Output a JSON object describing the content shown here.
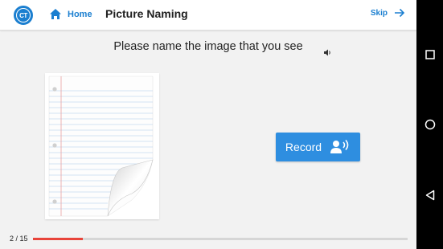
{
  "header": {
    "logo_text": "CT",
    "home_label": "Home",
    "title": "Picture Naming",
    "skip_label": "Skip"
  },
  "main": {
    "prompt": "Please name the image that you see",
    "record_label": "Record",
    "picture_subject": "notebook paper"
  },
  "progress": {
    "text": "2 / 15",
    "current": 2,
    "total": 15
  },
  "colors": {
    "accent": "#1b7fd0",
    "button": "#2e8ee0",
    "progress": "#e8443a"
  },
  "icons": [
    "home-icon",
    "arrow-right-icon",
    "speaker-icon",
    "voice-icon",
    "square-icon",
    "circle-icon",
    "triangle-back-icon"
  ]
}
